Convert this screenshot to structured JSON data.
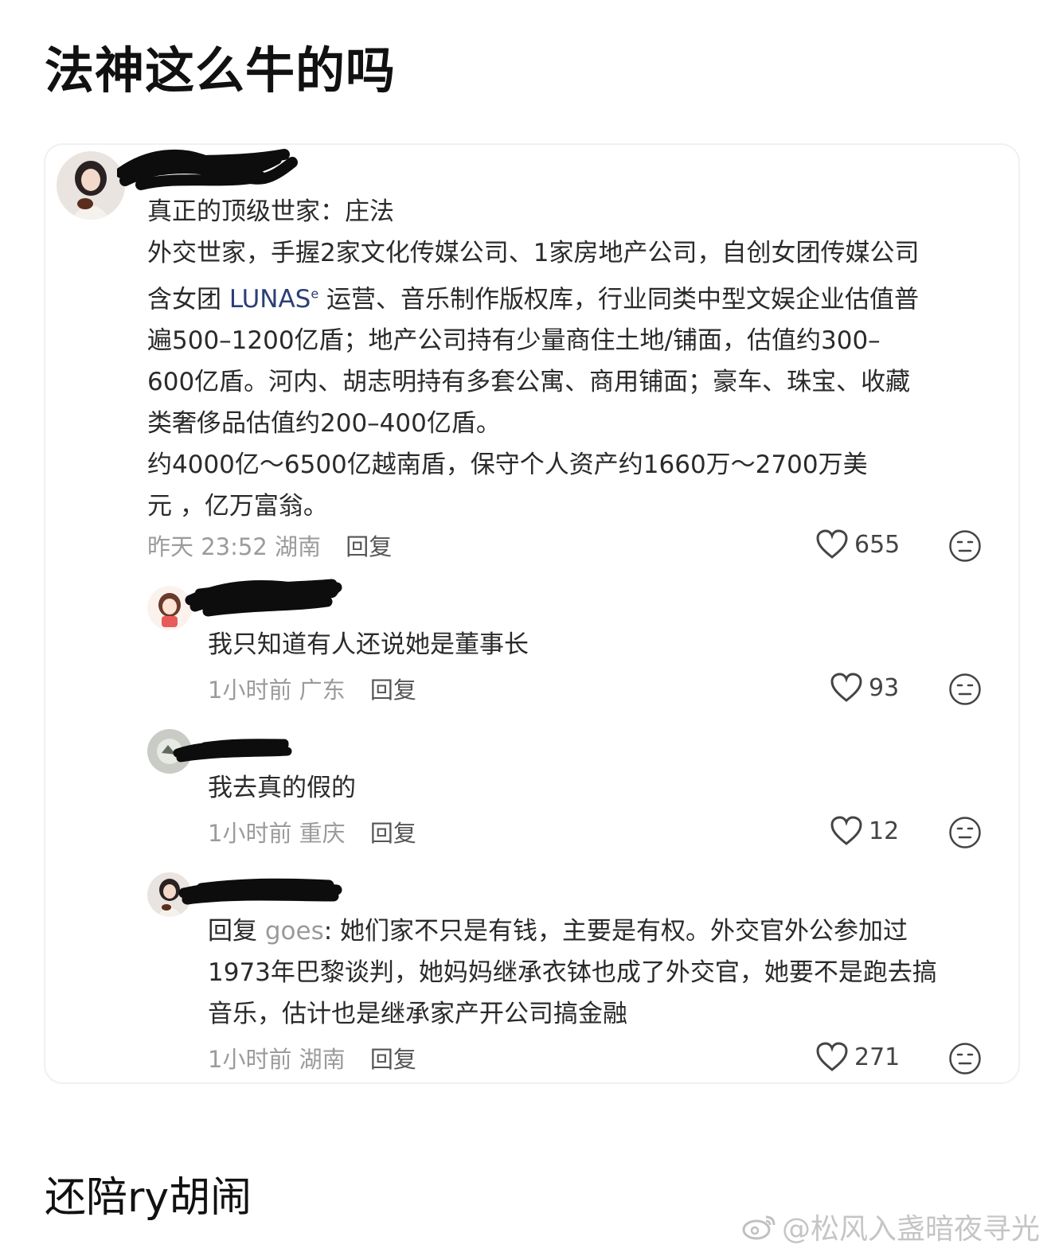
{
  "post": {
    "title": "法神这么牛的吗"
  },
  "comments": [
    {
      "lines": [
        "真正的顶级世家：庄法",
        "外交世家，手握2家文化传媒公司、1家房地产公司，自创女团传媒公司",
        "含女团 ",
        "LUNAS",
        " 运营、音乐制作版权库，行业同类中型文娱企业估值普",
        "遍500–1200亿盾；地产公司持有少量商住土地/铺面，估值约300–",
        "600亿盾。河内、胡志明持有多套公寓、商用铺面；豪车、珠宝、收藏",
        "类奢侈品估值约200–400亿盾。",
        "约4000亿～6500亿越南盾，保守个人资产约1660万～2700万美",
        "元 ，亿万富翁。"
      ],
      "time": "昨天 23:52",
      "location": "湖南",
      "reply_label": "回复",
      "likes": "655"
    },
    {
      "text": "我只知道有人还说她是董事长",
      "time": "1小时前",
      "location": "广东",
      "reply_label": "回复",
      "likes": "93"
    },
    {
      "text": "我去真的假的",
      "time": "1小时前",
      "location": "重庆",
      "reply_label": "回复",
      "likes": "12"
    },
    {
      "reply_prefix": "回复 ",
      "reply_target": "goes",
      "lines": [
        ": 她们家不只是有钱，主要是有权。外交官外公参加过",
        "1973年巴黎谈判，她妈妈继承衣钵也成了外交官，她要不是跑去搞",
        "音乐，估计也是继承家产开公司搞金融"
      ],
      "time": "1小时前",
      "location": "湖南",
      "reply_label": "回复",
      "likes": "271"
    }
  ],
  "footer": {
    "text": "还陪ry胡闹"
  },
  "watermark": {
    "text": "@松风入盏暗夜寻光"
  }
}
